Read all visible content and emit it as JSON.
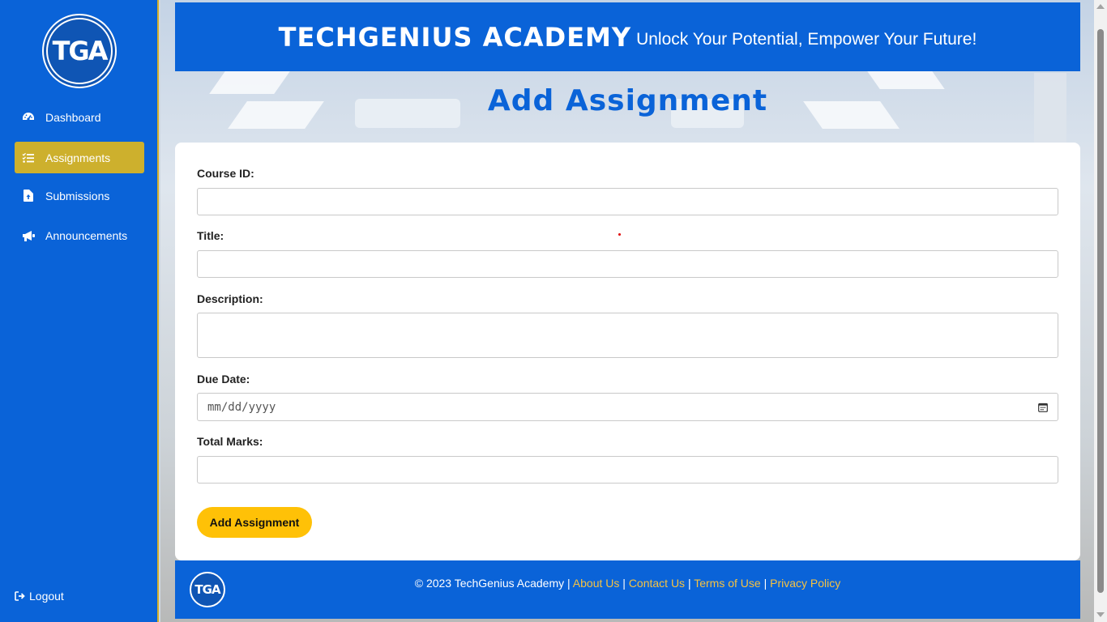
{
  "sidebar": {
    "logo_text": "TGA",
    "items": [
      {
        "label": "Dashboard",
        "icon": "gauge-icon"
      },
      {
        "label": "Assignments",
        "icon": "list-check-icon",
        "active": true
      },
      {
        "label": "Submissions",
        "icon": "file-upload-icon"
      },
      {
        "label": "Announcements",
        "icon": "megaphone-icon"
      }
    ],
    "logout_label": "Logout"
  },
  "header": {
    "brand": "TECHGENIUS ACADEMY",
    "tagline": "Unlock Your Potential, Empower Your Future!"
  },
  "page": {
    "title": "Add Assignment"
  },
  "form": {
    "course_id": {
      "label": "Course ID:",
      "value": ""
    },
    "title": {
      "label": "Title:",
      "value": ""
    },
    "description": {
      "label": "Description:",
      "value": ""
    },
    "due_date": {
      "label": "Due Date:",
      "placeholder": "mm/dd/yyyy"
    },
    "total_marks": {
      "label": "Total Marks:",
      "value": ""
    },
    "submit_label": "Add Assignment"
  },
  "footer": {
    "logo_text": "TGA",
    "copyright": "© 2023 TechGenius Academy",
    "links": [
      "About Us",
      "Contact Us",
      "Terms of Use",
      "Privacy Policy"
    ],
    "separator": "|"
  },
  "colors": {
    "primary": "#0a63d8",
    "active_nav": "#cdb02d",
    "button": "#ffc107",
    "footer_link": "#f5c242"
  }
}
